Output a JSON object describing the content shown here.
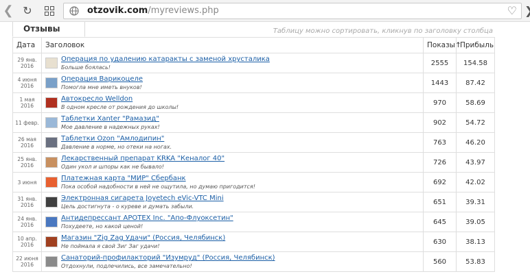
{
  "browser": {
    "back_glyph": "❯",
    "reload_glyph": "↻",
    "url_domain": "otzovik.com",
    "url_path": "/myreviews.php",
    "heart_glyph": "♡",
    "forward_glyph": "❯"
  },
  "page": {
    "tab_title": "Отзывы",
    "hint": "Таблицу можно сортировать, кликнув по заголовку столбца",
    "columns": {
      "date": "Дата",
      "title": "Заголовок",
      "views": "Показы↑",
      "profit": "Прибыль"
    }
  },
  "rows": [
    {
      "date": [
        "29 янв.",
        "2016"
      ],
      "title": "Операция по удалению катаракты с заменой хрусталика",
      "subtitle": "Больше боялась!",
      "views": "2555",
      "profit": "154.58"
    },
    {
      "date": [
        "4 июня",
        "2016"
      ],
      "title": "Операция Варикоцеле",
      "subtitle": "Помогла мне иметь внуков!",
      "views": "1443",
      "profit": "87.42"
    },
    {
      "date": [
        "1 мая",
        "2016"
      ],
      "title": "Автокресло Welldon",
      "subtitle": "В одном кресле от рождения до школы!",
      "views": "970",
      "profit": "58.69"
    },
    {
      "date": [
        "11 февр.",
        ""
      ],
      "title": "Таблетки Xanter \"Рамазид\"",
      "subtitle": "Мое давление в надежных руках!",
      "views": "902",
      "profit": "54.72"
    },
    {
      "date": [
        "26 мая",
        "2016"
      ],
      "title": "Таблетки Ozon \"Амлодипин\"",
      "subtitle": "Давление в норме, но отеки на ногах.",
      "views": "763",
      "profit": "46.20"
    },
    {
      "date": [
        "25 янв.",
        "2016"
      ],
      "title": "Лекарственный препарат KRKA \"Кеналог 40\"",
      "subtitle": "Один укол и шпоры как не бывало!",
      "views": "726",
      "profit": "43.97"
    },
    {
      "date": [
        "3 июня",
        ""
      ],
      "title": "Платежная карта \"МИР\" Сбербанк",
      "subtitle": "Пока особой надобности в ней не ощутила, но думаю пригодится!",
      "views": "692",
      "profit": "42.02"
    },
    {
      "date": [
        "31 янв.",
        "2016"
      ],
      "title": "Электронная сигарета Joyetech eVic-VTC Mini",
      "subtitle": "Цель достигнута - о куреве и думать забыли.",
      "views": "651",
      "profit": "39.31"
    },
    {
      "date": [
        "24 янв.",
        "2016"
      ],
      "title": "Антидепрессант APOTEX Inc. \"Апо-Флуоксетин\"",
      "subtitle": "Похудеете, но какой ценой!",
      "views": "645",
      "profit": "39.05"
    },
    {
      "date": [
        "10 апр.",
        "2016"
      ],
      "title": "Магазин \"Zig Zag Удачи\" (Россия, Челябинск)",
      "subtitle": "Не поймала я свой Зиг Заг удачи!",
      "views": "630",
      "profit": "38.13"
    },
    {
      "date": [
        "22 июня",
        "2016"
      ],
      "title": "Санаторий-профилакторий \"Изумруд\" (Россия, Челябинск)",
      "subtitle": "Отдохнули, подлечились, все замечательно!",
      "views": "560",
      "profit": "53.83"
    }
  ],
  "thumb_colors": [
    "#e8e0d0",
    "#7aa0c8",
    "#b03020",
    "#9ab8d8",
    "#6a7080",
    "#c89060",
    "#e86030",
    "#404040",
    "#4a78c0",
    "#a04020",
    "#8a8a8a"
  ]
}
